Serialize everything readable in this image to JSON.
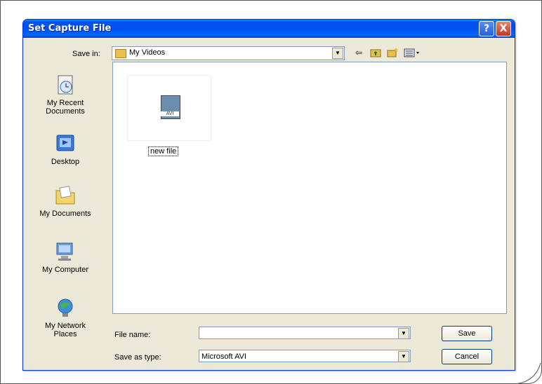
{
  "dialog": {
    "title": "Set Capture File",
    "help_button": "?",
    "close_button": "X"
  },
  "save_in": {
    "label": "Save in:",
    "value": "My Videos"
  },
  "toolbar": {
    "back_icon": "⇦",
    "up_folder_icon": "up-folder-icon",
    "new_folder_icon": "new-folder-icon",
    "views_icon": "views-menu-icon"
  },
  "places": [
    {
      "label": "My Recent Documents",
      "icon": "recent-documents-icon"
    },
    {
      "label": "Desktop",
      "icon": "desktop-icon"
    },
    {
      "label": "My Documents",
      "icon": "my-documents-icon"
    },
    {
      "label": "My Computer",
      "icon": "my-computer-icon"
    },
    {
      "label": "My Network Places",
      "icon": "network-places-icon"
    }
  ],
  "files": [
    {
      "name": "new file",
      "type_label": "AVI"
    }
  ],
  "file_name": {
    "label": "File name:",
    "value": ""
  },
  "save_as_type": {
    "label": "Save as type:",
    "value": "Microsoft AVI"
  },
  "buttons": {
    "save": "Save",
    "cancel": "Cancel"
  }
}
